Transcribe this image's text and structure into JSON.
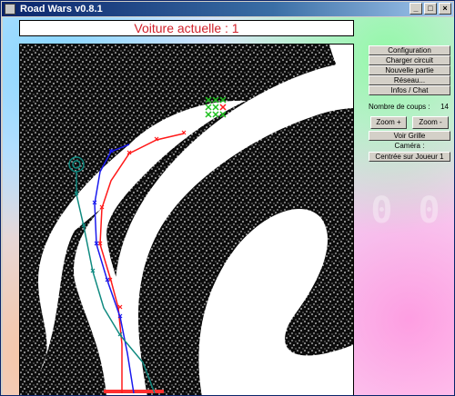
{
  "window": {
    "title": "Road Wars v0.8.1"
  },
  "status": {
    "current_car": "Voiture actuelle : 1"
  },
  "sidebar": {
    "config": "Configuration",
    "load": "Charger circuit",
    "new_game": "Nouvelle partie",
    "network": "Réseau...",
    "info_chat": "Infos / Chat",
    "moves_label": "Nombre de coups :",
    "moves_count": "14",
    "zoom_in": "Zoom +",
    "zoom_out": "Zoom -",
    "grid": "Voir Grille",
    "camera_label": "Caméra :",
    "camera_value": "Centrée sur Joueur 1"
  },
  "colors": {
    "player1": "#ff1a1a",
    "player2": "#1a1aee",
    "player3": "#108a80",
    "goal": "#20c020"
  }
}
